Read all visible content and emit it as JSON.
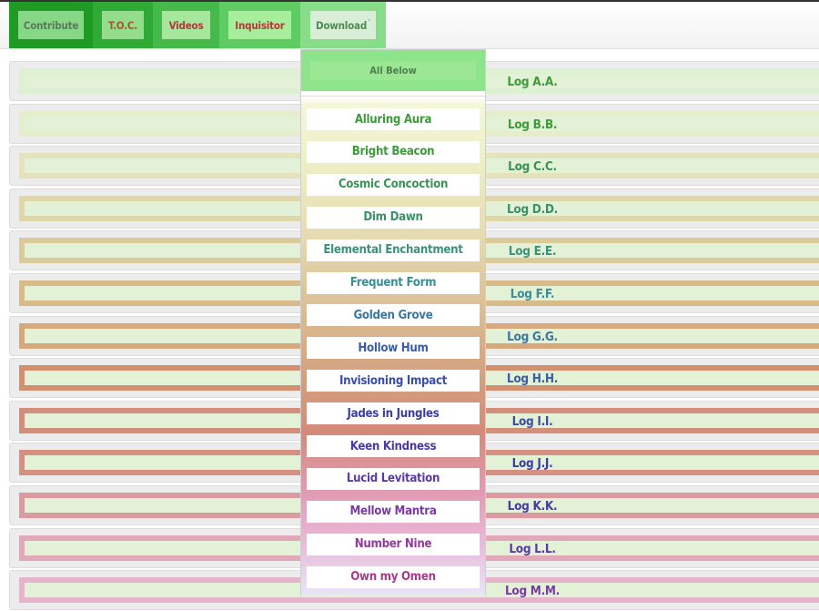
{
  "nav": {
    "items": [
      {
        "label": "Contribute"
      },
      {
        "label": "T.O.C."
      },
      {
        "label": "Videos"
      },
      {
        "label": "Inquisitor"
      },
      {
        "label": "Download",
        "caret": "ˇ"
      }
    ]
  },
  "dropdown": {
    "header": "All Below",
    "items": [
      {
        "label": "Alluring Aura",
        "color": "#3e9a3a"
      },
      {
        "label": "Bright Beacon",
        "color": "#3e9a3a"
      },
      {
        "label": "Cosmic Concoction",
        "color": "#3a9356"
      },
      {
        "label": "Dim Dawn",
        "color": "#3a9068"
      },
      {
        "label": "Elemental Enchantment",
        "color": "#3b927a"
      },
      {
        "label": "Frequent Form",
        "color": "#3a8f96"
      },
      {
        "label": "Golden Grove",
        "color": "#3b76a0"
      },
      {
        "label": "Hollow Hum",
        "color": "#3a5da6"
      },
      {
        "label": "Invisioning Impact",
        "color": "#3a4ea6"
      },
      {
        "label": "Jades in Jungles",
        "color": "#3a3ea6"
      },
      {
        "label": "Keen Kindness",
        "color": "#4a3aa6"
      },
      {
        "label": "Lucid Levitation",
        "color": "#5a3aa6"
      },
      {
        "label": "Mellow Mantra",
        "color": "#7a3aa6"
      },
      {
        "label": "Number Nine",
        "color": "#923a9a"
      },
      {
        "label": "Own my Omen",
        "color": "#a83a8a"
      }
    ]
  },
  "logs": [
    {
      "label": "Log A.A.",
      "color": "#3e9a3a",
      "frame": "#def0d2"
    },
    {
      "label": "Log B.B.",
      "color": "#3e9a3a",
      "frame": "#e6edcc"
    },
    {
      "label": "Log C.C.",
      "color": "#3a9356",
      "frame": "#e4e3bc"
    },
    {
      "label": "Log D.D.",
      "color": "#3a9068",
      "frame": "#e0d7a8"
    },
    {
      "label": "Log E.E.",
      "color": "#3b927a",
      "frame": "#dccb9a"
    },
    {
      "label": "Log F.F.",
      "color": "#3a8f96",
      "frame": "#d9bb8a"
    },
    {
      "label": "Log G.G.",
      "color": "#3b76a0",
      "frame": "#d6a87c"
    },
    {
      "label": "Log H.H.",
      "color": "#3a5da6",
      "frame": "#d3906e"
    },
    {
      "label": "Log I.I.",
      "color": "#3a4ea6",
      "frame": "#d48f7a"
    },
    {
      "label": "Log J.J.",
      "color": "#3a3ea6",
      "frame": "#d69082"
    },
    {
      "label": "Log K.K.",
      "color": "#4a3aa6",
      "frame": "#db9aa0"
    },
    {
      "label": "Log L.L.",
      "color": "#5a3aa6",
      "frame": "#e0a8b8"
    },
    {
      "label": "Log M.M.",
      "color": "#7a3aa6",
      "frame": "#e6b5cc"
    }
  ]
}
